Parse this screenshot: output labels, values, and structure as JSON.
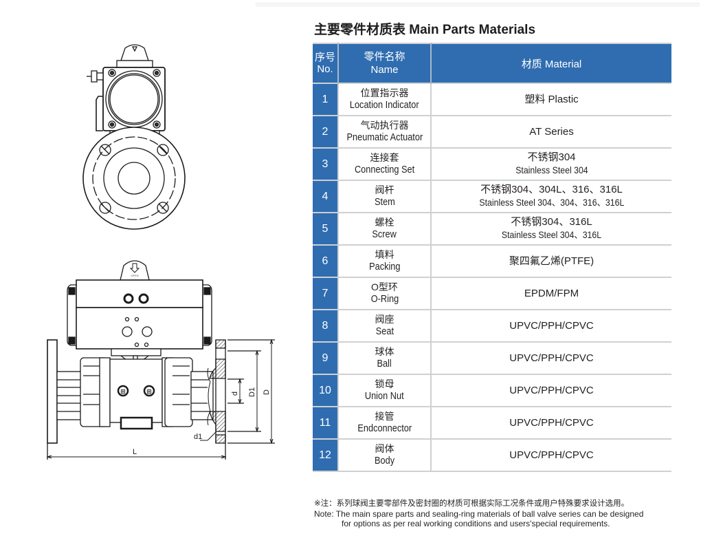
{
  "title": "主要零件材质表 Main Parts Materials",
  "table": {
    "header": {
      "no_cn": "序号",
      "no_en": "No.",
      "name_cn": "零件名称",
      "name_en": "Name",
      "material": "材质 Material"
    },
    "rows": [
      {
        "no": "1",
        "name_cn": "位置指示器",
        "name_en": "Location Indicator",
        "material": "塑料 Plastic",
        "material_en": ""
      },
      {
        "no": "2",
        "name_cn": "气动执行器",
        "name_en": "Pneumatic Actuator",
        "material": "AT Series",
        "material_en": ""
      },
      {
        "no": "3",
        "name_cn": "连接套",
        "name_en": "Connecting Set",
        "material": "不锈钢304",
        "material_en": "Stainless Steel 304"
      },
      {
        "no": "4",
        "name_cn": "阀杆",
        "name_en": "Stem",
        "material": "不锈钢304、304L、316、316L",
        "material_en": "Stainless Steel 304、304、316、316L"
      },
      {
        "no": "5",
        "name_cn": "螺栓",
        "name_en": "Screw",
        "material": "不锈钢304、316L",
        "material_en": "Stainless Steel 304、316L"
      },
      {
        "no": "6",
        "name_cn": "填料",
        "name_en": "Packing",
        "material": "聚四氟乙烯(PTFE)",
        "material_en": ""
      },
      {
        "no": "7",
        "name_cn": "O型环",
        "name_en": "O-Ring",
        "material": "EPDM/FPM",
        "material_en": ""
      },
      {
        "no": "8",
        "name_cn": "阀座",
        "name_en": "Seat",
        "material": "UPVC/PPH/CPVC",
        "material_en": ""
      },
      {
        "no": "9",
        "name_cn": "球体",
        "name_en": "Ball",
        "material": "UPVC/PPH/CPVC",
        "material_en": ""
      },
      {
        "no": "10",
        "name_cn": "锁母",
        "name_en": "Union Nut",
        "material": "UPVC/PPH/CPVC",
        "material_en": ""
      },
      {
        "no": "11",
        "name_cn": "接管",
        "name_en": "Endconnector",
        "material": "UPVC/PPH/CPVC",
        "material_en": ""
      },
      {
        "no": "12",
        "name_cn": "阀体",
        "name_en": "Body",
        "material": "UPVC/PPH/CPVC",
        "material_en": ""
      }
    ]
  },
  "note": {
    "cn": "※注：系列球阀主要零部件及密封圈的材质可根据实际工况条件或用户特殊要求设计选用。",
    "en_line1": "Note:  The main spare parts and sealing-ring materials of ball valve series can be designed",
    "en_line2": "for options as per real working conditions and users'special requirements."
  },
  "drawing": {
    "indicator_label": "OPEN",
    "dim_L": "L",
    "dim_D": "D",
    "dim_D1": "D1",
    "dim_d": "d",
    "dim_d1": "d1"
  },
  "colors": {
    "header_blue": "#2f6db0",
    "grid_gray": "#cfd0d2"
  }
}
